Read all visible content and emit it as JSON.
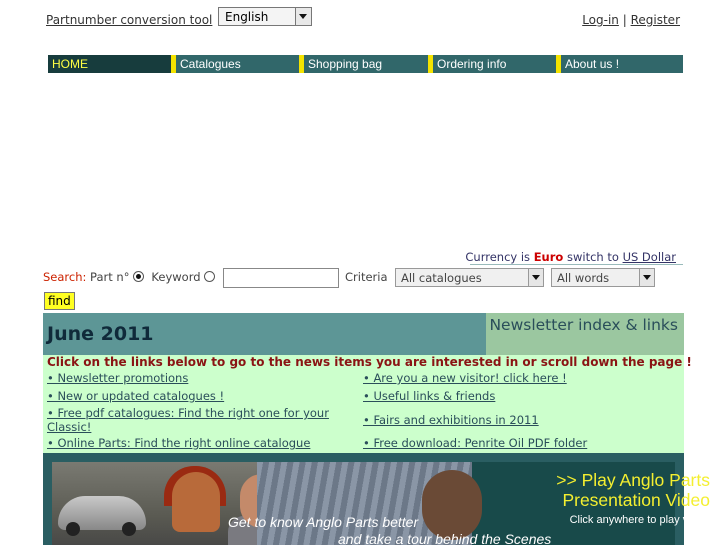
{
  "header": {
    "partnumber_link": "Partnumber conversion tool",
    "language": "English",
    "login": "Log-in",
    "separator": "|",
    "register": "Register"
  },
  "nav": {
    "items": [
      "HOME",
      "Catalogues",
      "Shopping bag",
      "Ordering info",
      "About us !"
    ]
  },
  "currency": {
    "prefix": "Currency is",
    "current": "Euro",
    "switch_text": "switch to",
    "switch_link": "US Dollar"
  },
  "search": {
    "label": "Search:",
    "option1": "Part n°",
    "option2": "Keyword",
    "input_value": "",
    "criteria_label": "Criteria",
    "catalogue_select": "All catalogues",
    "words_select": "All words",
    "find_button": "find"
  },
  "newsletter": {
    "title": "June 2011",
    "index_link": "Newsletter index & links",
    "instructions": "Click on the links below to go to the news items you are interested in or scroll down the page !",
    "left_links": [
      "• Newsletter promotions",
      "• New or updated catalogues !",
      "• Free pdf catalogues: Find the right one for your Classic!",
      "• Online Parts: Find the right online catalogue"
    ],
    "right_links": [
      "• Are you a new visitor! click here !",
      "• Useful links & friends",
      "• Fairs and exhibitions in 2011",
      "• Free download: Penrite Oil PDF folder"
    ]
  },
  "banner": {
    "play_line1": ">> Play Anglo Parts",
    "play_line2": "Presentation Video",
    "click_text": "Click anywhere to play video",
    "know_text": "Get to know Anglo Parts better",
    "tour_text": "and take a tour behind the Scenes"
  },
  "colors": {
    "nav_bg": "#31676a",
    "nav_separator": "#f4e300",
    "panel_bg": "#ccffcc",
    "panel_header": "#5d9696",
    "instructions": "#8a1414",
    "euro": "#cc0000",
    "find_button": "#ffff22"
  }
}
